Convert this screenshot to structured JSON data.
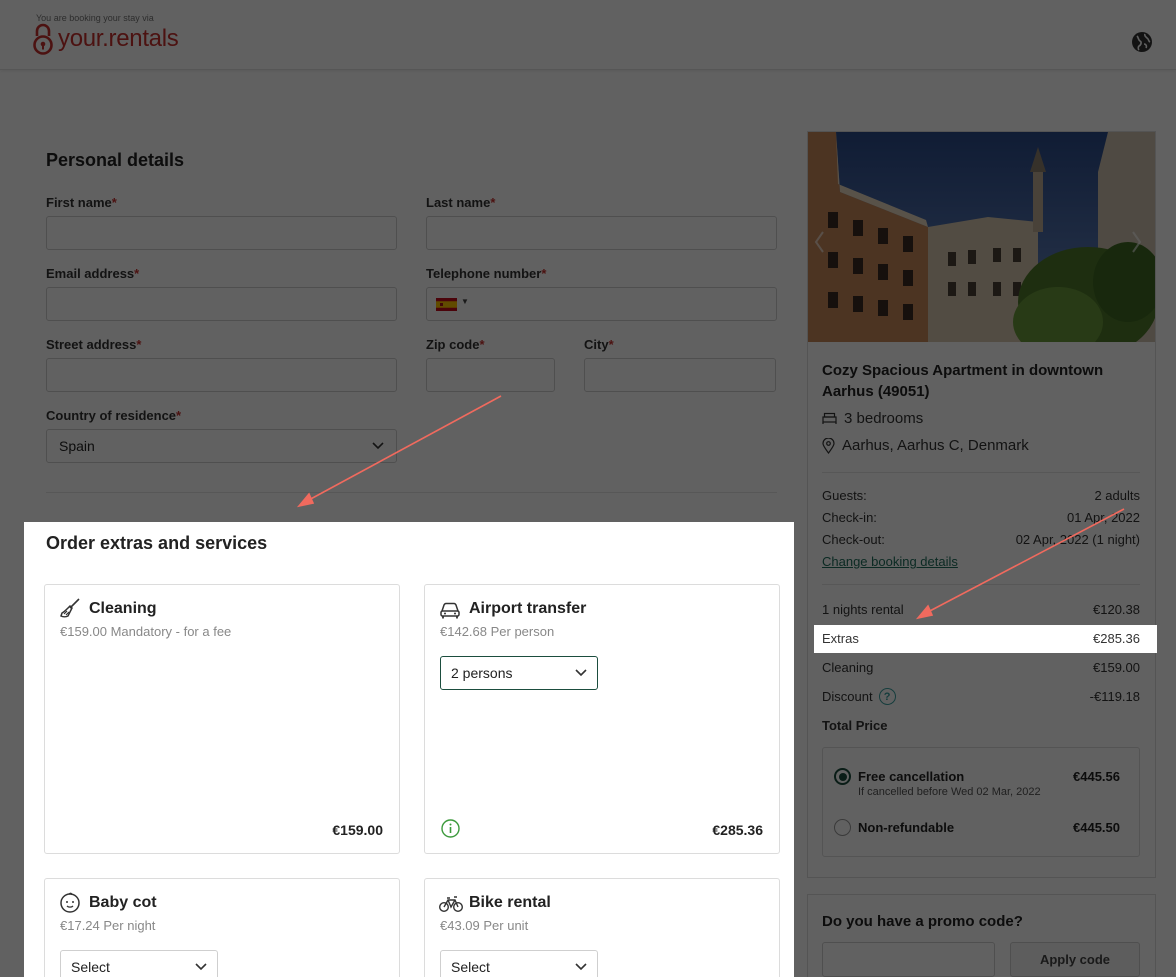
{
  "header": {
    "tagline": "You are booking your stay via",
    "brand": "your.rentals",
    "brand_color": "#c9312f",
    "language_icon": "globe-icon"
  },
  "personal": {
    "title": "Personal details",
    "first_name": "First name",
    "last_name": "Last name",
    "email": "Email address",
    "telephone": "Telephone number",
    "street": "Street address",
    "zip": "Zip code",
    "city": "City",
    "country": "Country of residence",
    "country_value": "Spain",
    "required_mark": "*"
  },
  "extras": {
    "title": "Order extras and services",
    "cards": [
      {
        "name": "Cleaning",
        "subtitle": "€159.00 Mandatory - for a fee",
        "price": "€159.00",
        "icon": "broom-icon"
      },
      {
        "name": "Airport transfer",
        "subtitle": "€142.68 Per person",
        "select": "2 persons",
        "price": "€285.36",
        "icon": "car-icon",
        "info_icon": "info-icon"
      },
      {
        "name": "Baby cot",
        "subtitle": "€17.24 Per night",
        "select": "Select",
        "icon": "baby-face-icon"
      },
      {
        "name": "Bike rental",
        "subtitle": "€43.09 Per unit",
        "select": "Select",
        "icon": "bicycle-icon"
      }
    ]
  },
  "sidebar": {
    "property_title": "Cozy Spacious Apartment in downtown Aarhus (49051)",
    "bedrooms": "3 bedrooms",
    "location": "Aarhus, Aarhus C, Denmark",
    "guests_label": "Guests:",
    "guests_value": "2 adults",
    "checkin_label": "Check-in:",
    "checkin_value": "01 Apr, 2022",
    "checkout_label": "Check-out:",
    "checkout_value": "02 Apr, 2022 (1 night)",
    "change_link": "Change booking details",
    "lines": [
      {
        "label": "1 nights rental",
        "value": "€120.38"
      },
      {
        "label": "Extras",
        "value": "€285.36"
      },
      {
        "label": "Cleaning",
        "value": "€159.00"
      },
      {
        "label": "Discount",
        "value": "-€119.18"
      }
    ],
    "total_label": "Total Price",
    "options": [
      {
        "label": "Free cancellation",
        "sub": "If cancelled before Wed 02 Mar, 2022",
        "price": "€445.56",
        "selected": true
      },
      {
        "label": "Non-refundable",
        "price": "€445.50",
        "selected": false
      }
    ],
    "promo_title": "Do you have a promo code?",
    "promo_button": "Apply code"
  },
  "colors": {
    "accent_green": "#1b4d3e",
    "link_teal": "#1f6f5c",
    "arrow": "#f06a5e"
  }
}
